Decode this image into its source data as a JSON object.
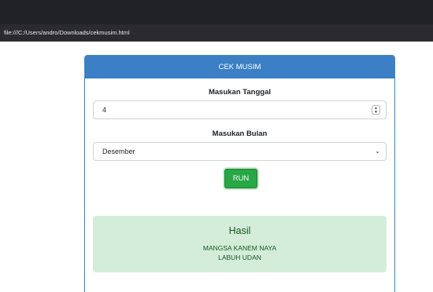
{
  "browser": {
    "url": "file:///C:/Users/andro/Downloads/cekmusim.html"
  },
  "card": {
    "title": "CEK MUSIM",
    "date_label": "Masukan Tanggal",
    "date_value": "4",
    "month_label": "Masukan Bulan",
    "month_selected": "Desember",
    "run_label": "RUN"
  },
  "result": {
    "title": "Hasil",
    "line1": "MANGSA KANEM NAYA",
    "line2": "LABUH UDAN"
  },
  "colors": {
    "header": "#3b7fc4",
    "run_button": "#28a745",
    "result_bg": "#d4edda",
    "result_text": "#155724"
  },
  "icons": {
    "spinner": "spinner-arrows-icon",
    "dropdown": "chevron-down-icon"
  }
}
